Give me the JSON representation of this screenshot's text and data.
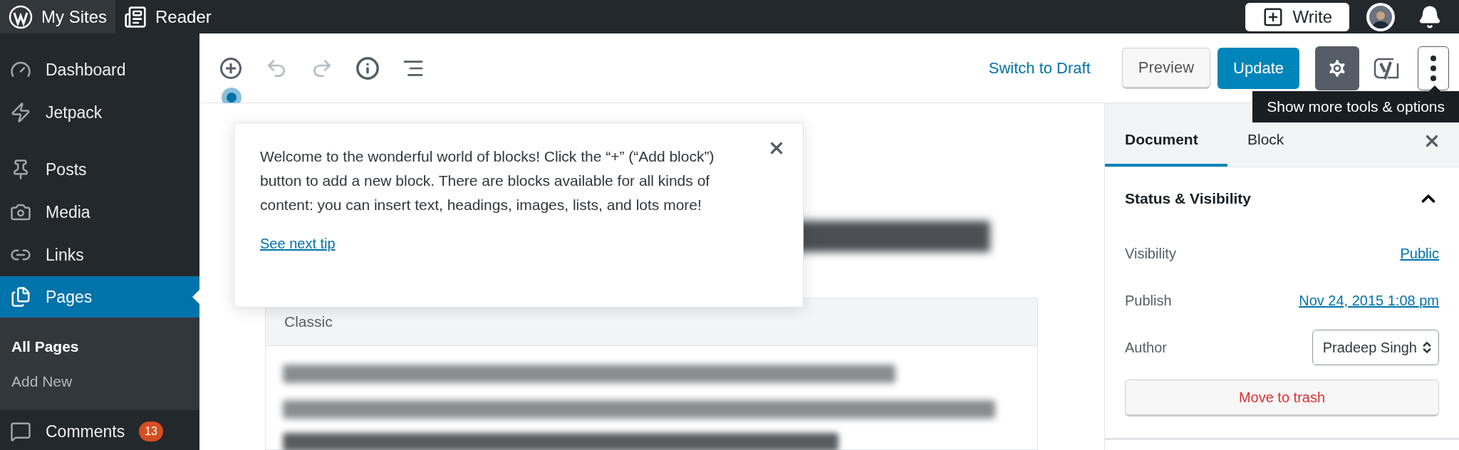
{
  "top_bar": {
    "items": [
      {
        "label": "My Sites",
        "selected": true
      },
      {
        "label": "Reader",
        "selected": false
      }
    ],
    "write_button": "Write"
  },
  "admin_menu": {
    "groups": [
      {
        "items": [
          {
            "label": "Dashboard",
            "selected": false
          },
          {
            "label": "Jetpack",
            "selected": false
          }
        ]
      },
      {
        "items": [
          {
            "label": "Posts",
            "selected": false
          },
          {
            "label": "Media",
            "selected": false
          },
          {
            "label": "Links",
            "selected": false
          },
          {
            "label": "Pages",
            "selected": true,
            "children": [
              {
                "label": "All Pages",
                "selected": true
              },
              {
                "label": "Add New",
                "selected": false
              }
            ]
          },
          {
            "label": "Comments",
            "selected": false,
            "badge": "13"
          }
        ]
      }
    ]
  },
  "toolbar": {
    "switch_to_draft": "Switch to Draft",
    "preview": "Preview",
    "update": "Update",
    "settings_active": true,
    "tooltip": "Show more tools & options"
  },
  "tip": {
    "text": "Welcome to the wonderful world of blocks! Click the “+” (“Add block”) button to add a new block. There are blocks available for all kinds of content: you can insert text, headings, images, lists, and lots more!",
    "link": "See next tip"
  },
  "editor": {
    "block_label": "Classic"
  },
  "settings_panel": {
    "tabs": [
      {
        "label": "Document",
        "selected": true
      },
      {
        "label": "Block",
        "selected": false
      }
    ],
    "section": {
      "title": "Status & Visibility",
      "expanded": true,
      "rows": [
        {
          "kind": "link",
          "label": "Visibility",
          "value": "Public"
        },
        {
          "kind": "link",
          "label": "Publish",
          "value": "Nov 24, 2015 1:08 pm"
        },
        {
          "kind": "select",
          "label": "Author",
          "value": "Pradeep Singh"
        }
      ],
      "trash_button": "Move to trash"
    }
  }
}
